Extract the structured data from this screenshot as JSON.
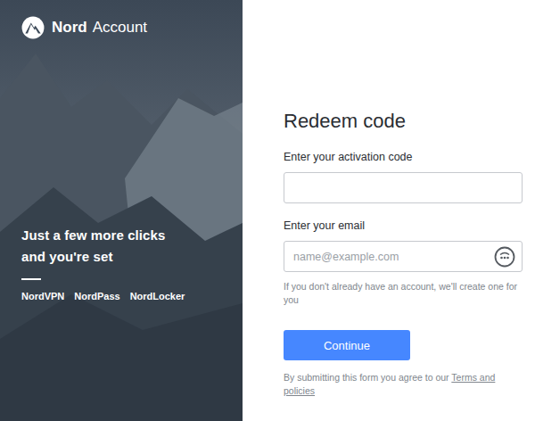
{
  "brand": {
    "name": "Nord",
    "suffix": "Account"
  },
  "hero": {
    "headline_lines": [
      "Just a few more clicks",
      "and you're set"
    ],
    "products": [
      "NordVPN",
      "NordPass",
      "NordLocker"
    ]
  },
  "form": {
    "title": "Redeem code",
    "fields": [
      {
        "label": "Enter your activation code",
        "kind": "plain"
      },
      {
        "label": "Enter your email",
        "placeholder": "name@example.com",
        "kind": "autofill"
      }
    ],
    "helper": "If you don't already have an account, we'll create one for you",
    "submit": "Continue",
    "terms_prefix": "By submitting this form you agree to our",
    "terms_link": "Terms and policies"
  }
}
